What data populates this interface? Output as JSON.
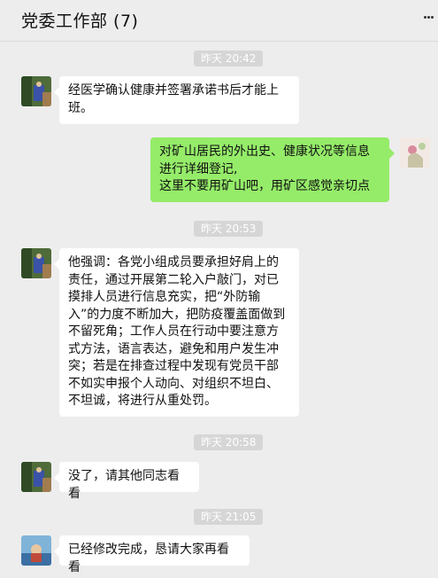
{
  "header": {
    "title": "党委工作部 (7)"
  },
  "messages": [
    {
      "time": "昨天 20:42"
    },
    {
      "text": "经医学确认健康并签署承诺书后才能上班。"
    },
    {
      "text": "对矿山居民的外出史、健康状况等信息进行详细登记,\n这里不要用矿山吧，用矿区感觉亲切点"
    },
    {
      "time": "昨天 20:53"
    },
    {
      "text": "他强调：各党小组成员要承担好肩上的责任，通过开展第二轮入户敲门，对已摸排人员进行信息充实，把“外防输入”的力度不断加大，把防疫覆盖面做到不留死角；工作人员在行动中要注意方式方法，语言表达，避免和用户发生冲突；若是在排查过程中发现有党员干部不如实申报个人动向、对组织不坦白、不坦诚，将进行从重处罚。"
    },
    {
      "time": "昨天 20:58"
    },
    {
      "text": "没了，请其他同志看看"
    },
    {
      "time": "昨天 21:05"
    },
    {
      "text": "已经修改完成，恳请大家再看看"
    }
  ],
  "colors": {
    "background": "#ededed",
    "bubble_self": "#95ec69",
    "bubble_other": "#ffffff",
    "time_badge": "#d6d6d6"
  },
  "icons": {
    "more": "more-dots-icon"
  }
}
